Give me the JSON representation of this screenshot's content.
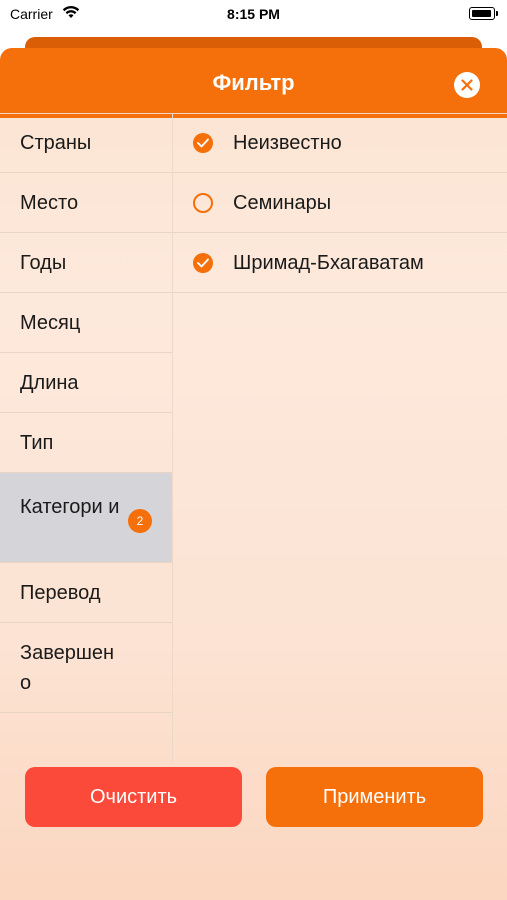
{
  "status_bar": {
    "carrier": "Carrier",
    "time": "8:15 PM"
  },
  "modal": {
    "title": "Фильтр"
  },
  "sidebar": {
    "items": [
      {
        "label": "Страны"
      },
      {
        "label": "Место"
      },
      {
        "label": "Годы"
      },
      {
        "label": "Месяц"
      },
      {
        "label": "Длина"
      },
      {
        "label": "Тип"
      },
      {
        "label": "Категори и",
        "badge": "2",
        "selected": true
      },
      {
        "label": "Перевод"
      },
      {
        "label": "Завершен о"
      }
    ]
  },
  "options": [
    {
      "label": "Неизвестно",
      "checked": true
    },
    {
      "label": "Семинары",
      "checked": false
    },
    {
      "label": "Шримад-Бхагаватам",
      "checked": true
    }
  ],
  "buttons": {
    "clear": "Очистить",
    "apply": "Применить"
  },
  "colors": {
    "accent": "#f56f0a",
    "clear_button": "#fb4a3a",
    "selected_row": "#d5d4d8"
  },
  "icons": {
    "close": "close-icon",
    "check": "checkmark-icon",
    "wifi": "wifi-icon",
    "battery": "battery-icon"
  }
}
